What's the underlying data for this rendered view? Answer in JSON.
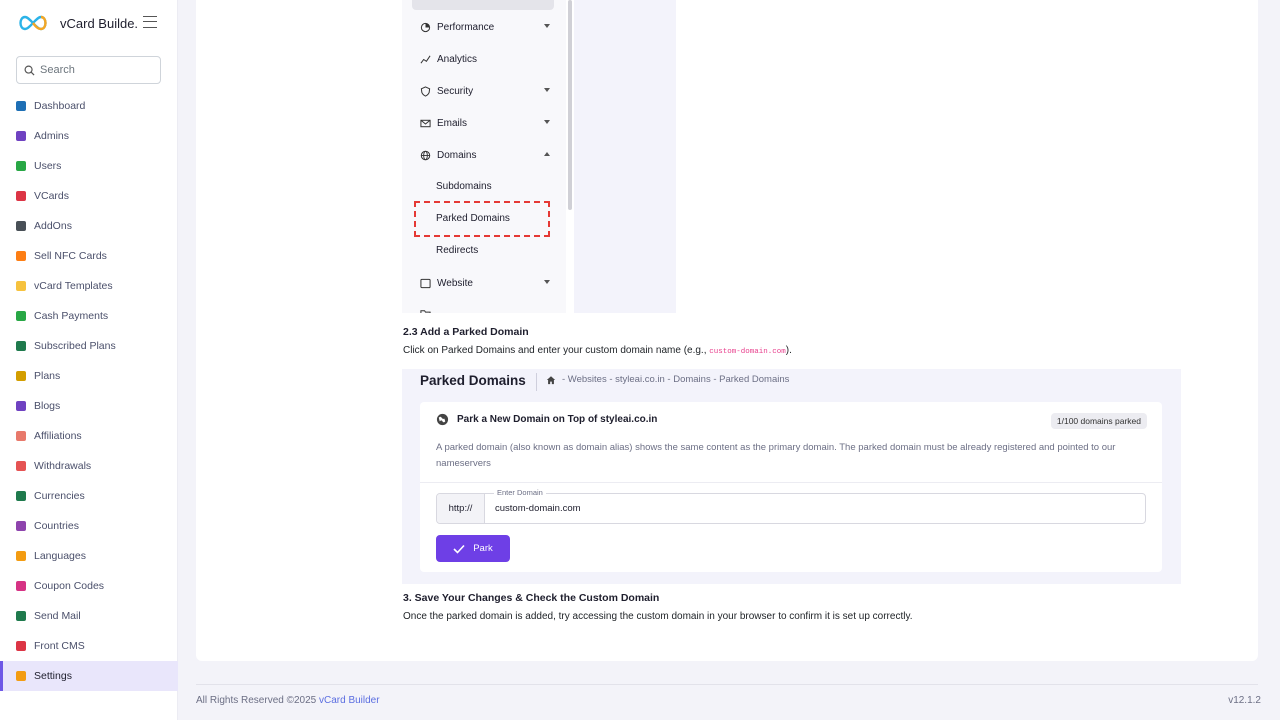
{
  "brand": {
    "name": "vCard Builde..."
  },
  "search": {
    "placeholder": "Search"
  },
  "sidebar": {
    "items": [
      {
        "label": "Dashboard",
        "color": "#1e6fb5"
      },
      {
        "label": "Admins",
        "color": "#6f42c1"
      },
      {
        "label": "Users",
        "color": "#28a745"
      },
      {
        "label": "VCards",
        "color": "#dc3545"
      },
      {
        "label": "AddOns",
        "color": "#495057"
      },
      {
        "label": "Sell NFC Cards",
        "color": "#fd7e14"
      },
      {
        "label": "vCard Templates",
        "color": "#f6c23e"
      },
      {
        "label": "Cash Payments",
        "color": "#28a745"
      },
      {
        "label": "Subscribed Plans",
        "color": "#1f7a4d"
      },
      {
        "label": "Plans",
        "color": "#d39e00"
      },
      {
        "label": "Blogs",
        "color": "#6f42c1"
      },
      {
        "label": "Affiliations",
        "color": "#e8796b"
      },
      {
        "label": "Withdrawals",
        "color": "#e55353"
      },
      {
        "label": "Currencies",
        "color": "#1f7a4d"
      },
      {
        "label": "Countries",
        "color": "#8e44ad"
      },
      {
        "label": "Languages",
        "color": "#f39c12"
      },
      {
        "label": "Coupon Codes",
        "color": "#d63384"
      },
      {
        "label": "Send Mail",
        "color": "#1f7a4d"
      },
      {
        "label": "Front CMS",
        "color": "#dc3545"
      },
      {
        "label": "Settings",
        "color": "#f39c12"
      }
    ],
    "active_index": 19
  },
  "menu_shot": {
    "items": {
      "performance": "Performance",
      "analytics": "Analytics",
      "security": "Security",
      "emails": "Emails",
      "domains": "Domains",
      "subdomains": "Subdomains",
      "parked": "Parked Domains",
      "redirects": "Redirects",
      "website": "Website"
    }
  },
  "content": {
    "step23_title": "2.3 Add a Parked Domain",
    "step23_text_a": "Click on Parked Domains and enter your custom domain name (e.g., ",
    "step23_code": "custom-domain.com",
    "step23_text_b": ").",
    "step3_title": "3. Save Your Changes & Check the Custom Domain",
    "step3_text": "Once the parked domain is added, try accessing the custom domain in your browser to confirm it is set up correctly."
  },
  "parked_shot": {
    "title": "Parked Domains",
    "breadcrumb": "- Websites - styleai.co.in - Domains - Parked Domains",
    "panel_title": "Park a New Domain on Top of styleai.co.in",
    "badge": "1/100 domains parked",
    "description": "A parked domain (also known as domain alias) shows the same content as the primary domain. The parked domain must be already registered and pointed to our nameservers",
    "prefix": "http://",
    "field_label": "Enter Domain",
    "field_value": "custom-domain.com",
    "button": "Park"
  },
  "footer": {
    "text": "All Rights Reserved ©2025 ",
    "link": "vCard Builder",
    "version": "v12.1.2"
  }
}
